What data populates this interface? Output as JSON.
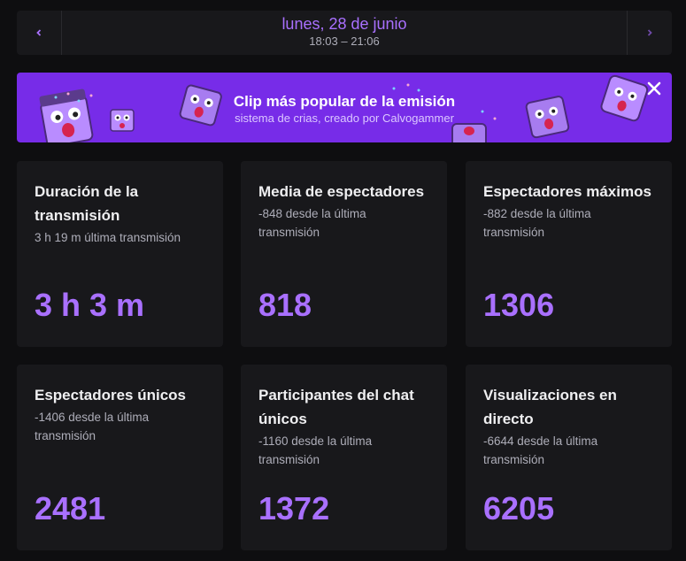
{
  "date_nav": {
    "title": "lunes, 28 de junio",
    "time_range": "18:03 – 21:06",
    "prev_icon": "chevron-left-icon",
    "next_icon": "chevron-right-icon"
  },
  "banner": {
    "title": "Clip más popular de la emisión",
    "subtitle": "sistema de crias, creado por Calvogammer",
    "close_icon": "close-icon",
    "background": "#772ce8"
  },
  "stats": [
    {
      "title": "Duración de la transmisión",
      "subtitle": "3 h 19 m última transmisión",
      "value": "3 h 3 m"
    },
    {
      "title": "Media de espectadores",
      "subtitle": "-848 desde la última transmisión",
      "value": "818"
    },
    {
      "title": "Espectadores máximos",
      "subtitle": "-882 desde la última transmisión",
      "value": "1306"
    },
    {
      "title": "Espectadores únicos",
      "subtitle": "-1406 desde la última transmisión",
      "value": "2481"
    },
    {
      "title": "Participantes del chat únicos",
      "subtitle": "-1160 desde la última transmisión",
      "value": "1372"
    },
    {
      "title": "Visualizaciones en directo",
      "subtitle": "-6644 desde la última transmisión",
      "value": "6205"
    }
  ],
  "colors": {
    "accent": "#a970ff",
    "card_bg": "#18181b",
    "page_bg": "#0e0e10"
  }
}
